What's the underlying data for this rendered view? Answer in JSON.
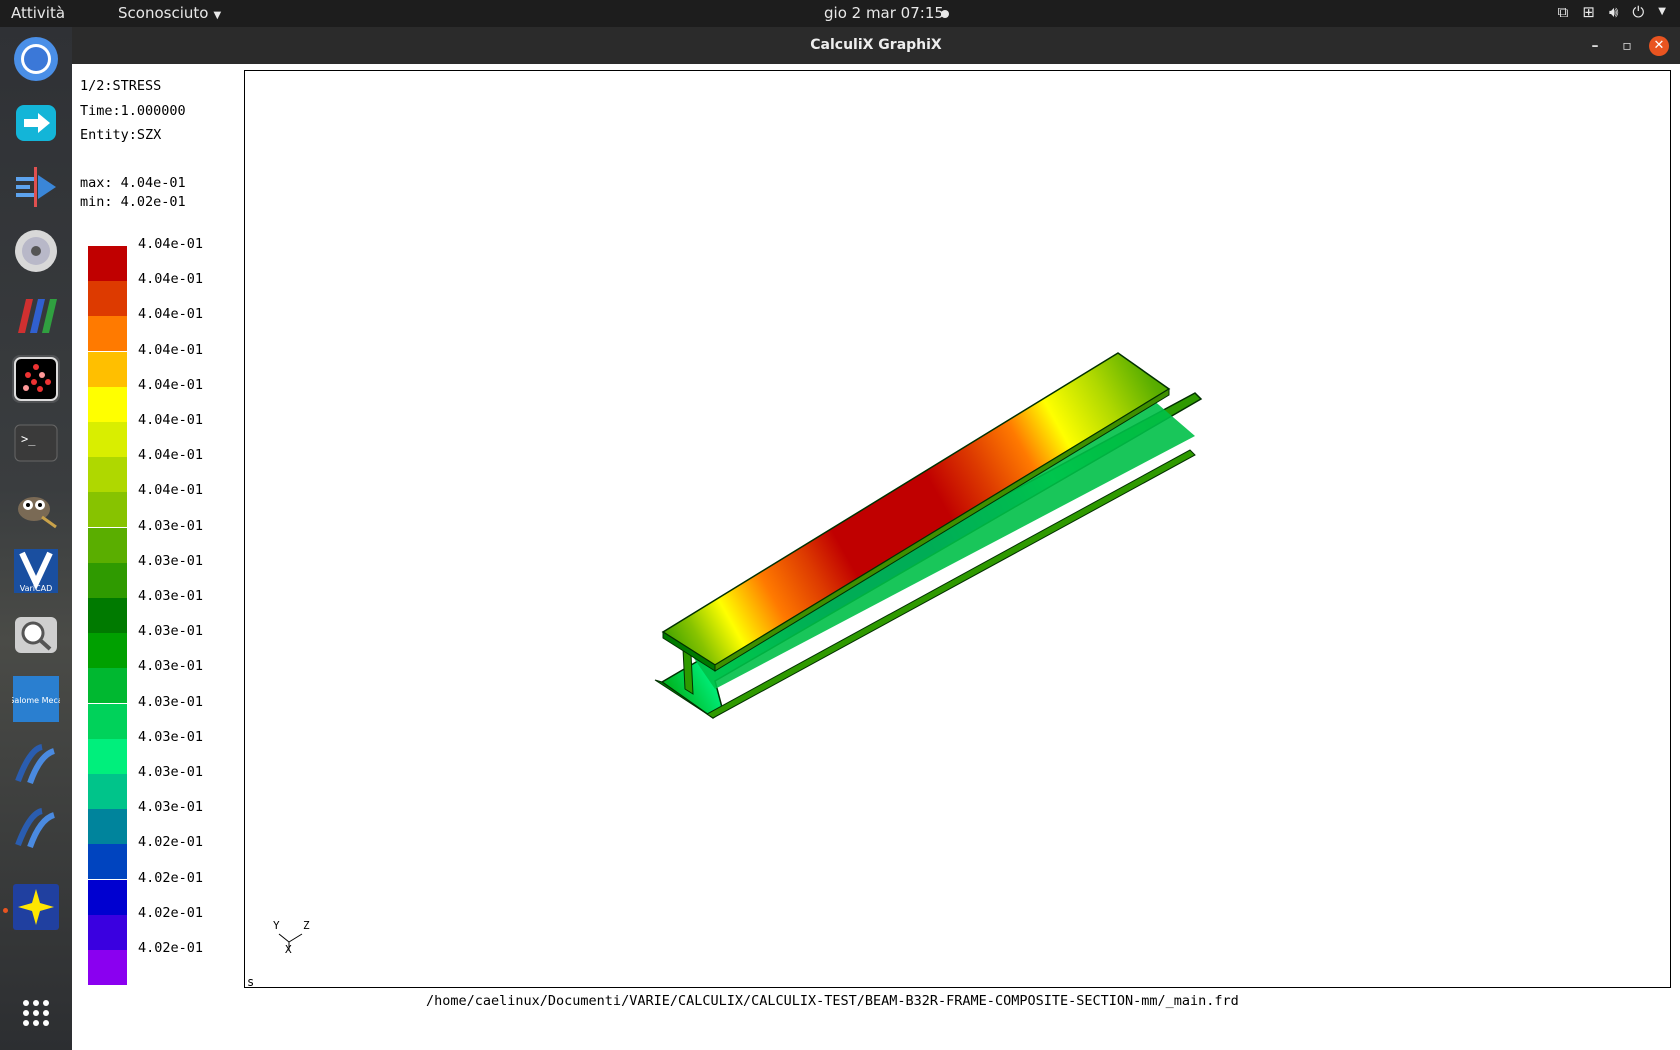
{
  "topbar": {
    "activities": "Attività",
    "app_menu": "Sconosciuto",
    "clock": "gio 2 mar  07:15"
  },
  "dock": {
    "items": [
      {
        "name": "chromium-icon"
      },
      {
        "name": "anydesk-icon"
      },
      {
        "name": "kdenlive-icon"
      },
      {
        "name": "disc-icon"
      },
      {
        "name": "paraview-icon"
      },
      {
        "name": "calculix-icon"
      },
      {
        "name": "terminal-icon"
      },
      {
        "name": "gimp-icon"
      },
      {
        "name": "varicad-icon",
        "label": "VariCAD"
      },
      {
        "name": "search-icon"
      },
      {
        "name": "salome-meca-icon",
        "label": "Salome Meca"
      },
      {
        "name": "salome-icon"
      },
      {
        "name": "salome-icon-2"
      },
      {
        "name": "star-app-icon"
      },
      {
        "name": "app-grid-icon"
      }
    ]
  },
  "window": {
    "title": "CalculiX GraphiX",
    "info": {
      "line1": "1/2:STRESS",
      "line2": "Time:1.000000",
      "line3": "Entity:SZX",
      "max": "max: 4.04e-01",
      "min": "min: 4.02e-01"
    },
    "legend": [
      {
        "label": "4.04e-01",
        "color": "#c00000"
      },
      {
        "label": "4.04e-01",
        "color": "#dd3a00"
      },
      {
        "label": "4.04e-01",
        "color": "#ff7a00"
      },
      {
        "label": "4.04e-01",
        "color": "#ffbf00"
      },
      {
        "label": "4.04e-01",
        "color": "#ffff00"
      },
      {
        "label": "4.04e-01",
        "color": "#d9ee00"
      },
      {
        "label": "4.04e-01",
        "color": "#afd800"
      },
      {
        "label": "4.04e-01",
        "color": "#87c300"
      },
      {
        "label": "4.03e-01",
        "color": "#5aae00"
      },
      {
        "label": "4.03e-01",
        "color": "#2f9a00"
      },
      {
        "label": "4.03e-01",
        "color": "#007a00"
      },
      {
        "label": "4.03e-01",
        "color": "#00a000"
      },
      {
        "label": "4.03e-01",
        "color": "#00b830"
      },
      {
        "label": "4.03e-01",
        "color": "#00d25a"
      },
      {
        "label": "4.03e-01",
        "color": "#00ef7c"
      },
      {
        "label": "4.03e-01",
        "color": "#00c48a"
      },
      {
        "label": "4.03e-01",
        "color": "#00849c"
      },
      {
        "label": "4.02e-01",
        "color": "#0044bf"
      },
      {
        "label": "4.02e-01",
        "color": "#0000d0"
      },
      {
        "label": "4.02e-01",
        "color": "#3a00e0"
      },
      {
        "label": "4.02e-01",
        "color": "#8a00f0"
      }
    ],
    "triad": {
      "x": "X",
      "y": "Y",
      "z": "Z"
    },
    "viewport_marker": "s",
    "file_path": "/home/caelinux/Documenti/VARIE/CALCULIX/CALCULIX-TEST/BEAM-B32R-FRAME-COMPOSITE-SECTION-mm/_main.frd"
  }
}
